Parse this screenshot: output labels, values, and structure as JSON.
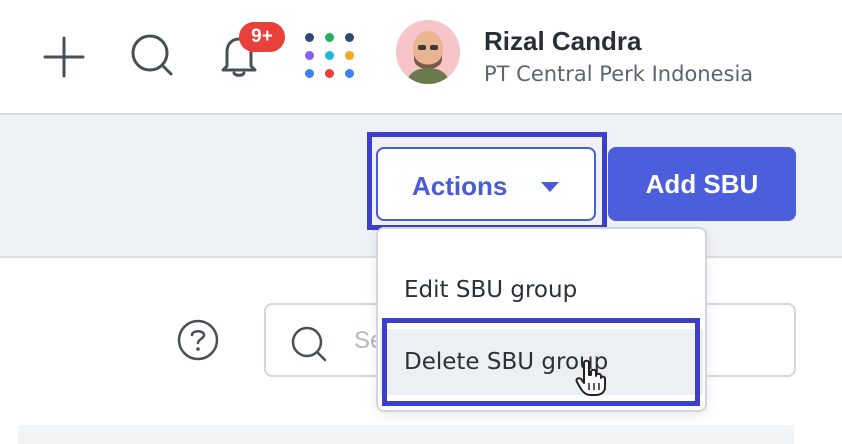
{
  "topbar": {
    "notification_badge": "9+",
    "user": {
      "name": "Rizal Candra",
      "company": "PT Central Perk Indonesia"
    },
    "icons": [
      "plus-icon",
      "search-icon",
      "bell-icon",
      "apps-grid-icon"
    ],
    "apps_grid_colors": [
      "#2e4a7a",
      "#1fb35a",
      "#2e4a7a",
      "#8b5cf6",
      "#22b8d6",
      "#f5a623",
      "#3b82f6",
      "#e8413b",
      "#3b82f6"
    ]
  },
  "actions": {
    "actions_label": "Actions",
    "add_label": "Add SBU",
    "menu": [
      {
        "label": "Edit SBU group"
      },
      {
        "label": "Delete SBU group"
      }
    ]
  },
  "search": {
    "placeholder_visible": "Se"
  },
  "colors": {
    "primary": "#4b5edc",
    "highlight": "#3b3fc9",
    "badge": "#e8413b"
  }
}
